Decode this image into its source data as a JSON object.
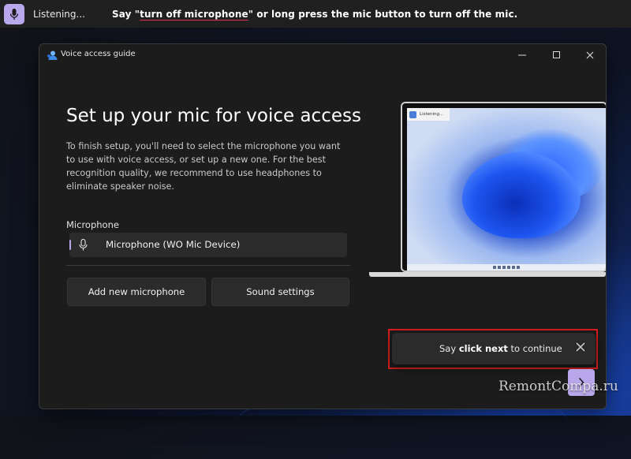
{
  "voice_access_bar": {
    "status": "Listening...",
    "hint_prefix": "Say \"",
    "hint_command": "turn off microphone",
    "hint_suffix": "\" or long press the mic button to turn off the mic."
  },
  "window": {
    "title": "Voice access guide",
    "heading": "Set up your mic for voice access",
    "description": "To finish setup, you'll need to select the microphone you want to use with voice access, or set up a new one. For the best recognition quality, we recommend to use headphones to eliminate speaker noise.",
    "microphone_label": "Microphone",
    "microphone_value": "Microphone (WO Mic Device)",
    "buttons": {
      "add_microphone": "Add new microphone",
      "sound_settings": "Sound settings"
    },
    "illustration": {
      "listening_label": "Listening..."
    }
  },
  "tip": {
    "prefix": "Say ",
    "command": "click next",
    "suffix": " to continue"
  },
  "watermark": "RemontCompa.ru",
  "colors": {
    "accent": "#b8a7ea",
    "highlight_border": "#d91e1e"
  }
}
